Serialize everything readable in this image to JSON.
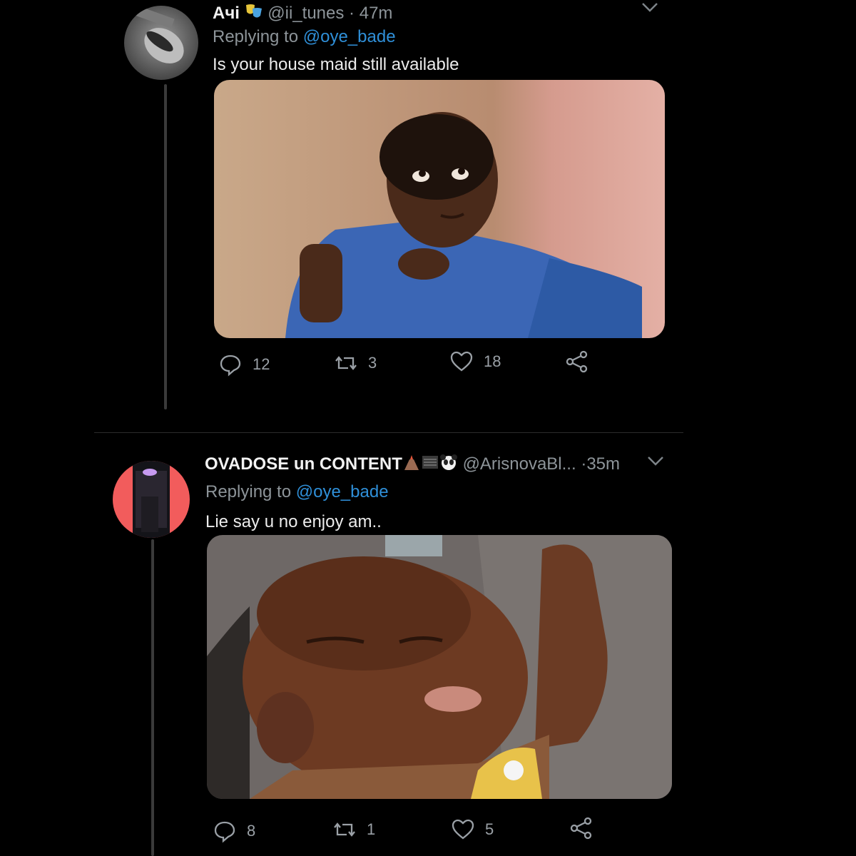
{
  "tweets": [
    {
      "name": "Ачі",
      "handle": "@ii_tunes",
      "dot": "·",
      "time": "47m",
      "replying_prefix": "Replying to",
      "replying_mention": "@oye_bade",
      "text": "Is your house maid still available",
      "media_icon": "photo-meme-boy-looking-up",
      "stats": {
        "replies": "12",
        "retweets": "3",
        "likes": "18"
      }
    },
    {
      "name": "OVADOSE un CONTENT",
      "handle": "@ArisnovaBl...",
      "dot": "·",
      "time": "35m",
      "replying_prefix": "Replying to",
      "replying_mention": "@oye_bade",
      "text": "Lie say u no enjoy am..",
      "media_icon": "photo-meme-baby-satisfied",
      "stats": {
        "replies": "8",
        "retweets": "1",
        "likes": "5"
      }
    }
  ],
  "icons": {
    "reply": "speech-bubble-icon",
    "retweet": "retweet-arrows-icon",
    "like": "heart-icon",
    "share": "share-icon",
    "more": "chevron-down-icon"
  },
  "colors": {
    "background": "#000000",
    "mention": "#2f8fd8",
    "muted": "#8d9499",
    "avatar_ring": "#f25c5c"
  }
}
